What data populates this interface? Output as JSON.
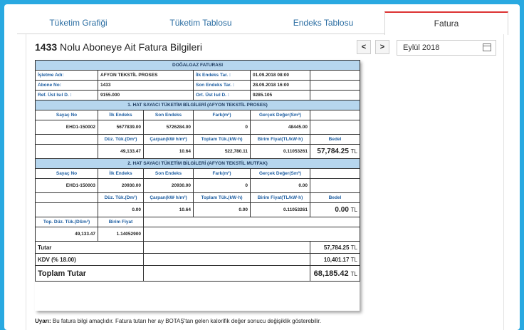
{
  "tabs": [
    "Tüketim Grafiği",
    "Tüketim Tablosu",
    "Endeks Tablosu",
    "Fatura"
  ],
  "header": {
    "subscriber_no": "1433",
    "title_rest": " Nolu Aboneye Ait Fatura Bilgileri"
  },
  "nav": {
    "prev": "<",
    "next": ">"
  },
  "period": "Eylül 2018",
  "invoice": {
    "title": "DOĞALGAZ FATURASI",
    "info": {
      "company_label": "İşletme Adı:",
      "company_value": "AFYON TEKSTİL PROSES",
      "first_date_label": "İlk Endeks Tar. :",
      "first_date_value": "01.09.2018 08:00",
      "subscriber_label": "Abone No:",
      "subscriber_value": "1433",
      "last_date_label": "Son Endeks Tar. :",
      "last_date_value": "28.09.2018 16:00",
      "ref_label": "Ref. Üst Isıl D. :",
      "ref_value": "9155.000",
      "avg_label": "Ort. Üst Isıl D. :",
      "avg_value": "9285.105"
    },
    "col_headers": {
      "meter": "Sayaç No",
      "first": "İlk Endeks",
      "last": "Son Endeks",
      "diff": "Fark(m³)",
      "real": "Gerçek Değer(Sm³)",
      "corrected": "Düz. Tük.(Dm³)",
      "factor": "Çarpan(kW·h/m³)",
      "total": "Toplam Tük.(kW·h)",
      "unit": "Birim Fiyat(TL/kW·h)",
      "amount": "Bedel"
    },
    "line1": {
      "title": "1. HAT SAYACI TÜKETİM BİLGİLERİ (AFYON TEKSTİL PROSES)",
      "meter": "EHD1-150002",
      "first": "5677839.00",
      "last": "5726284.00",
      "diff": "0",
      "real": "48445.00",
      "corrected": "49,133.47",
      "factor": "10.64",
      "total": "522,780.11",
      "unit": "0.11053261",
      "amount": "57,784.25",
      "currency": "TL"
    },
    "line2": {
      "title": "2. HAT SAYACI TÜKETİM BİLGİLERİ (AFYON TEKSTİL MUTFAK)",
      "meter": "EHD1-150003",
      "first": "20930.00",
      "last": "20930.00",
      "diff": "0",
      "real": "0.00",
      "corrected": "0.00",
      "factor": "10.64",
      "total": "0.00",
      "unit": "0.11053261",
      "amount": "0.00",
      "currency": "TL"
    },
    "summary": {
      "top_label": "Top. Düz. Tük.(DSm³)",
      "unit_label": "Birim Fiyat",
      "top_value": "49,133.47",
      "unit_value": "1.14052900",
      "subtotal_label": "Tutar",
      "subtotal_value": "57,784.25",
      "vat_label": "KDV (% 18.00)",
      "vat_value": "10,401.17",
      "total_label": "Toplam Tutar",
      "total_value": "68,185.42",
      "currency": "TL"
    }
  },
  "warning": {
    "label": "Uyarı:",
    "text": " Bu fatura bilgi amaçlıdır. Fatura tutarı her ay BOTAŞ'tan gelen kalorifik değer sonucu değişiklik gösterebilir."
  }
}
